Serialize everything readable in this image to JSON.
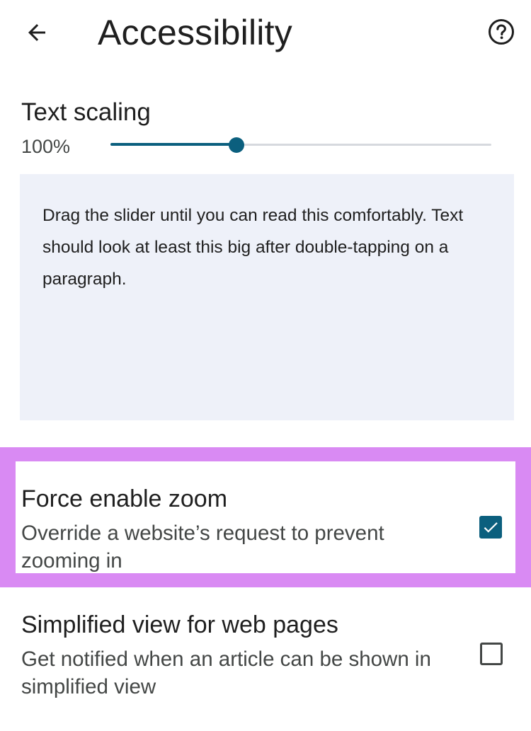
{
  "app_bar": {
    "title": "Accessibility",
    "back_icon": "arrow-back-icon",
    "help_icon": "help-circle-icon"
  },
  "text_scaling": {
    "label": "Text scaling",
    "value_text": "100%",
    "slider_fraction": 0.33,
    "preview_text": "Drag the slider until you can read this comfortably. Text should look at least this big after double-tapping on a paragraph."
  },
  "force_zoom": {
    "title": "Force enable zoom",
    "description": "Override a website’s request to prevent zooming in",
    "checked": true
  },
  "simplified_view": {
    "title": "Simplified view for web pages",
    "description": "Get notified when an article can be shown in simplified view",
    "checked": false
  },
  "colors": {
    "accent": "#0b5f7e",
    "highlight": "#d98af3",
    "preview_background": "#eef1f9"
  }
}
